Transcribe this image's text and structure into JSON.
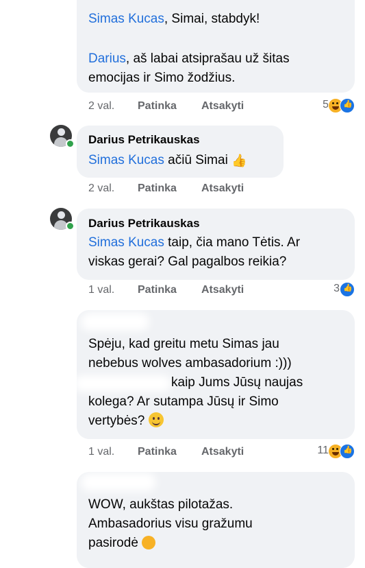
{
  "comments": [
    {
      "author": "",
      "lines": [
        {
          "mention": "Simas Kucas",
          "rest": ", Simai, stabdyk!"
        },
        {
          "mention": "",
          "rest": ""
        },
        {
          "mention": "Darius",
          "rest": ", aš labai atsiprašau už šitas"
        },
        {
          "mention": "",
          "rest": "emocijas ir Simo žodžius."
        }
      ],
      "time": "2 val.",
      "like": "Patinka",
      "reply": "Atsakyti",
      "reaction_count": "5"
    },
    {
      "author": "Darius Petrikauskas",
      "lines": [
        {
          "mention": "Simas Kucas",
          "rest": " ačiū Simai"
        }
      ],
      "time": "2 val.",
      "like": "Patinka",
      "reply": "Atsakyti",
      "reaction_count": ""
    },
    {
      "author": "Darius Petrikauskas",
      "lines": [
        {
          "mention": "Simas Kucas",
          "rest": " taip, čia mano Tėtis. Ar"
        },
        {
          "mention": "",
          "rest": "viskas gerai? Gal pagalbos reikia?"
        }
      ],
      "time": "1 val.",
      "like": "Patinka",
      "reply": "Atsakyti",
      "reaction_count": "3"
    },
    {
      "author": "",
      "lines": [
        {
          "mention": "",
          "rest": "Spėju, kad greitu metu Simas jau"
        },
        {
          "mention": "",
          "rest": "nebebus wolves ambasadorium :)))"
        },
        {
          "mention": "",
          "rest": "kaip Jums Jūsų naujas"
        },
        {
          "mention": "",
          "rest": "kolega? Ar sutampa Jūsų ir Simo"
        },
        {
          "mention": "",
          "rest": "vertybės?"
        }
      ],
      "time": "1 val.",
      "like": "Patinka",
      "reply": "Atsakyti",
      "reaction_count": "11"
    },
    {
      "author": "",
      "lines": [
        {
          "mention": "",
          "rest": "WOW, aukštas pilotažas."
        },
        {
          "mention": "",
          "rest": "Ambasadorius visu gražumu"
        },
        {
          "mention": "",
          "rest": "pasirodė"
        }
      ]
    }
  ],
  "icons": {
    "reaction_haha": "haha-reaction-icon",
    "reaction_like": "like-reaction-icon",
    "emoji_thumb": "thumbs-up-emoji",
    "emoji_smile": "smiling-face-emoji",
    "emoji_laugh": "laughing-emoji"
  },
  "colors": {
    "mention": "#216fdb",
    "bubble": "#f0f2f5",
    "meta": "#65676b",
    "like_blue": "#1b74e4",
    "haha_yellow": "#f7b125",
    "online_green": "#31a24c"
  }
}
